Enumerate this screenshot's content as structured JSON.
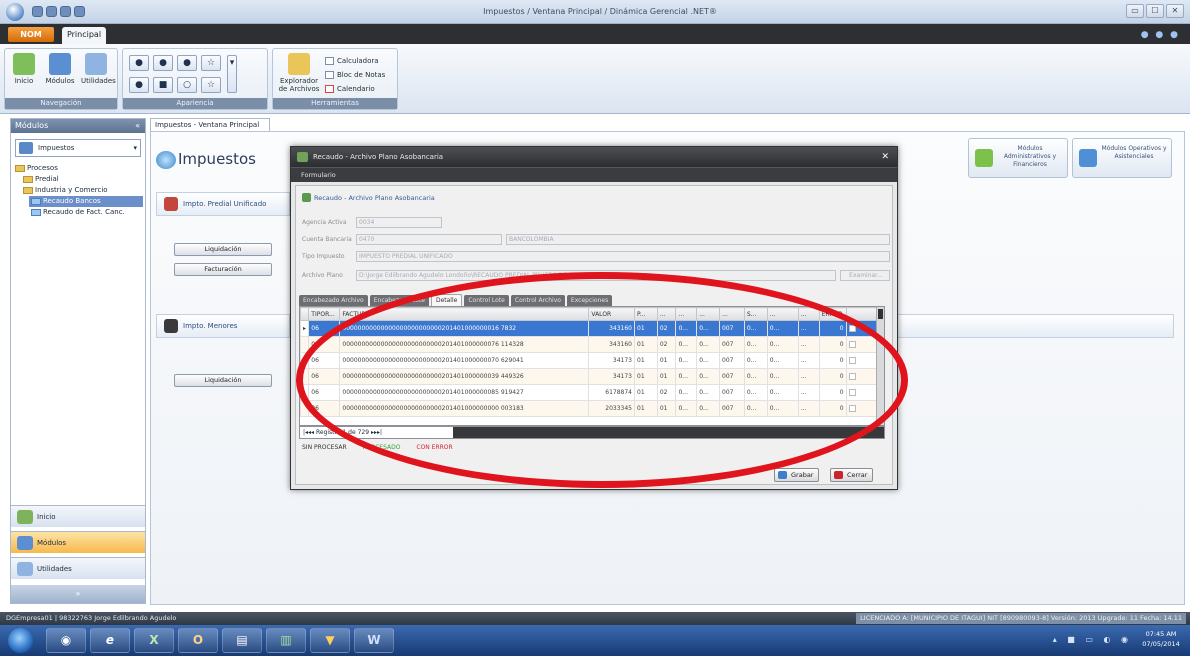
{
  "window": {
    "title": "Impuestos / Ventana Principal / Dinámica Gerencial .NET®",
    "controls": [
      "▭",
      "☐",
      "✕"
    ]
  },
  "ribbon": {
    "app_button": "NOM",
    "tabs": [
      "Principal"
    ],
    "groups": {
      "navigation": {
        "label": "Navegación",
        "buttons": [
          "Inicio",
          "Módulos",
          "Utilidades"
        ]
      },
      "appearance": {
        "label": "Apariencia"
      },
      "tools": {
        "label": "Herramientas",
        "explorer": "Explorador de Archivos",
        "items": [
          "Calculadora",
          "Bloc de Notas",
          "Calendario"
        ]
      }
    }
  },
  "modules_panel": {
    "header": "Módulos",
    "selected_module": "Impuestos",
    "tree": [
      {
        "label": "Procesos",
        "level": 0
      },
      {
        "label": "Predial",
        "level": 1
      },
      {
        "label": "Industria y Comercio",
        "level": 1
      },
      {
        "label": "Recaudo Bancos",
        "level": 2,
        "selected": true
      },
      {
        "label": "Recaudo de Fact. Canc.",
        "level": 2
      }
    ],
    "nav": [
      "Inicio",
      "Módulos",
      "Utilidades"
    ]
  },
  "document_tab": "Impuestos - Ventana Principal",
  "main": {
    "title": "Impuestos",
    "predial_section": "Impto. Predial Unificado",
    "predial_buttons": [
      "Liquidación",
      "Facturación"
    ],
    "menores_section": "Impto. Menores",
    "menores_buttons": [
      "Liquidación"
    ],
    "tiles": [
      "Módulos Administrativos y Financieros",
      "Módulos Operativos y Asistenciales"
    ]
  },
  "dialog": {
    "title": "Recaudo - Archivo Plano Asobancaria",
    "menu": "Formulario",
    "subtitle": "Recaudo - Archivo Plano Asobancaria",
    "fields": {
      "agencia_label": "Agencia Activa",
      "agencia_value": "0034",
      "cuenta_label": "Cuenta Bancaria",
      "cuenta_value": "0470",
      "banco_value": "BANCOLOMBIA",
      "tipo_label": "Tipo Impuesto",
      "tipo_value": "IMPUESTO PREDIAL UNIFICADO",
      "archivo_label": "Archivo Plano",
      "archivo_value": "D:\\Jorge Edilbrando Agudelo Londoño\\RECAUDO PREDIAL PRUEBA DE ES.txt",
      "examinar": "Examinar..."
    },
    "tabs": [
      "Encabezado Archivo",
      "Encabezado Lote",
      "Detalle",
      "Control Lote",
      "Control Archivo",
      "Excepciones"
    ],
    "active_tab": "Detalle",
    "grid": {
      "columns": [
        "TIPOR...",
        "FACTURA",
        "VALOR",
        "P...",
        "...",
        "...",
        "...",
        "...",
        "S...",
        "...",
        "...",
        "ERROR"
      ],
      "rows": [
        {
          "tipo": "06",
          "factura": "00000000000000000000000000201401000000016 7832",
          "valor": "343160",
          "c1": "01",
          "c2": "02",
          "c3": "0...",
          "c4": "0...",
          "c5": "007",
          "c6": "0...",
          "c7": "0...",
          "c8": "...",
          "err": "0"
        },
        {
          "tipo": "06",
          "factura": "00000000000000000000000000201401000000076 114328",
          "valor": "343160",
          "c1": "01",
          "c2": "02",
          "c3": "0...",
          "c4": "0...",
          "c5": "007",
          "c6": "0...",
          "c7": "0...",
          "c8": "...",
          "err": "0"
        },
        {
          "tipo": "06",
          "factura": "00000000000000000000000000201401000000070 629041",
          "valor": "34173",
          "c1": "01",
          "c2": "01",
          "c3": "0...",
          "c4": "0...",
          "c5": "007",
          "c6": "0...",
          "c7": "0...",
          "c8": "...",
          "err": "0"
        },
        {
          "tipo": "06",
          "factura": "00000000000000000000000000201401000000039 449326",
          "valor": "34173",
          "c1": "01",
          "c2": "01",
          "c3": "0...",
          "c4": "0...",
          "c5": "007",
          "c6": "0...",
          "c7": "0...",
          "c8": "...",
          "err": "0"
        },
        {
          "tipo": "06",
          "factura": "00000000000000000000000000201401000000085 919427",
          "valor": "6178874",
          "c1": "01",
          "c2": "02",
          "c3": "0...",
          "c4": "0...",
          "c5": "007",
          "c6": "0...",
          "c7": "0...",
          "c8": "...",
          "err": "0"
        },
        {
          "tipo": "06",
          "factura": "00000000000000000000000000201401000000000 003183",
          "valor": "2033345",
          "c1": "01",
          "c2": "01",
          "c3": "0...",
          "c4": "0...",
          "c5": "007",
          "c6": "0...",
          "c7": "0...",
          "c8": "...",
          "err": "0"
        }
      ]
    },
    "pager": "Registro 1 de 729",
    "legend": [
      "SIN PROCESAR",
      "PROCESADO",
      "CON ERROR"
    ],
    "legend_colors": [
      "#333333",
      "#3aa33a",
      "#d4262b"
    ],
    "buttons": [
      "Grabar",
      "Cerrar"
    ]
  },
  "statusbar": {
    "left": "DGEmpresa01  |  98322763 Jorge Edilbrando Agudelo",
    "right": "LICENCIADO A: [MUNICIPIO DE ITAGUI] NIT [890980093-8]  Versión: 2013 Upgrade: 11 Fecha: 14.11"
  },
  "taskbar": {
    "apps": [
      "◉",
      "e",
      "X",
      "O",
      "▤",
      "▥",
      "▼",
      "W"
    ],
    "time": "07:45 AM",
    "date": "07/05/2014"
  }
}
